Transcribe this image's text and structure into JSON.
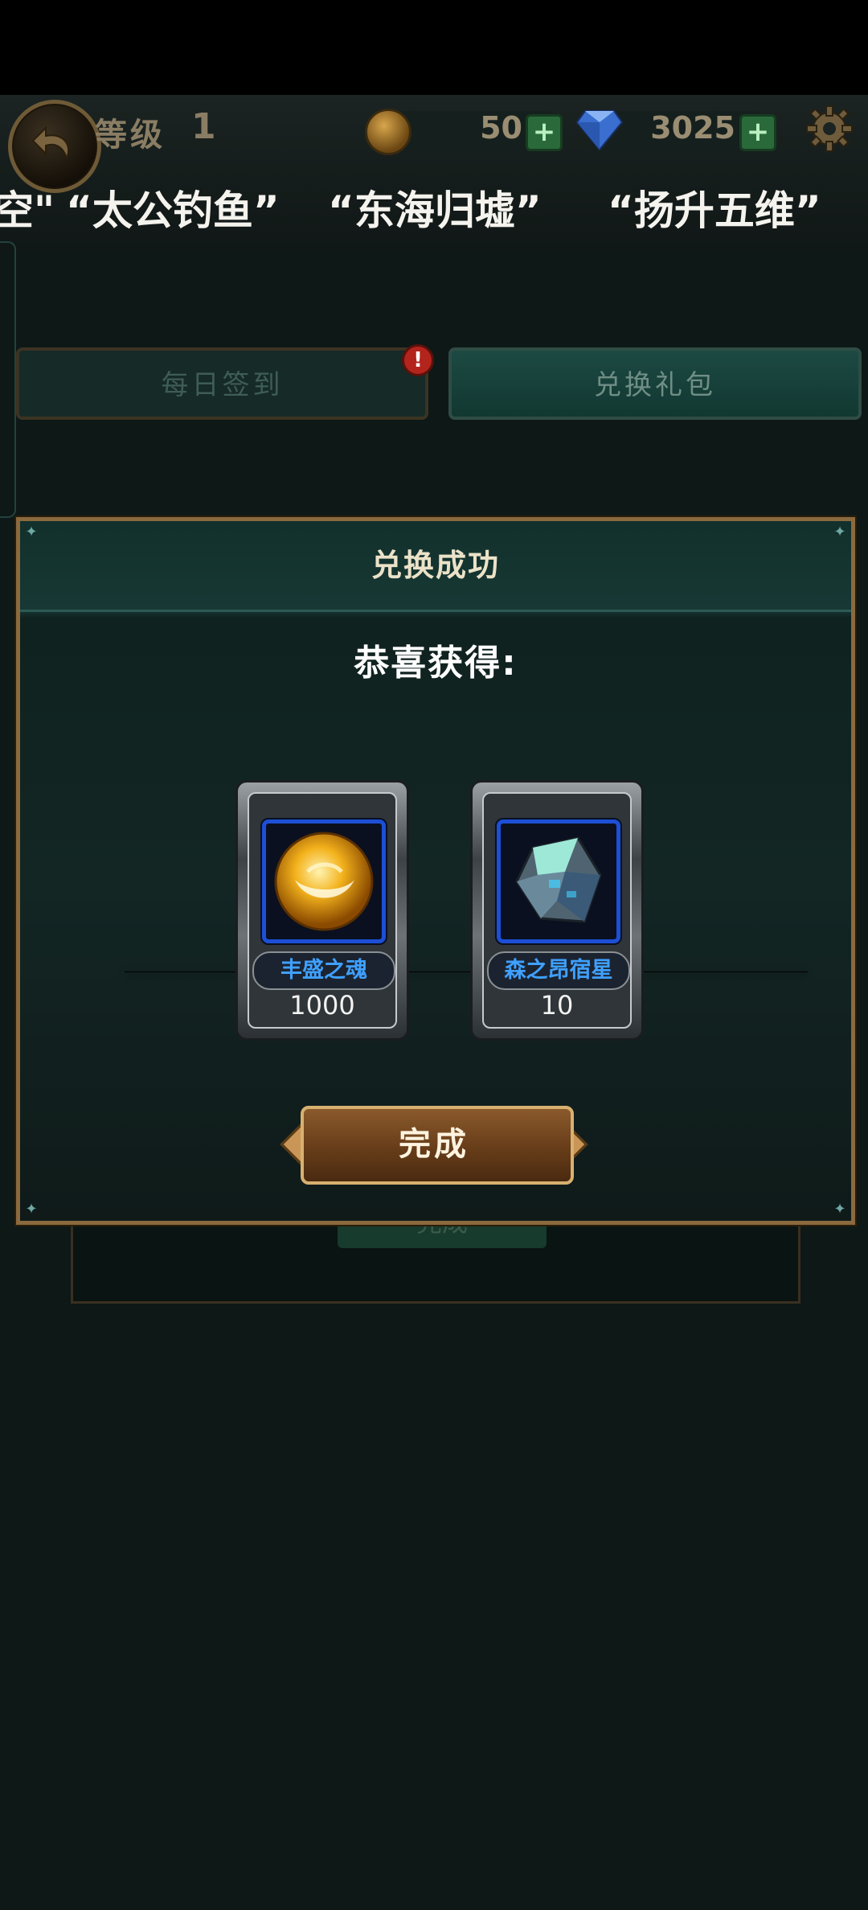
{
  "header": {
    "level_label": "等级",
    "level_value": "1",
    "coins": "50",
    "gems": "3025",
    "plus_label": "+"
  },
  "marquee": {
    "items": [
      "空\"",
      "“太公钓鱼”",
      "“东海归墟”",
      "“扬升五维”"
    ]
  },
  "tabs": {
    "daily": "每日签到",
    "gift": "兑换礼包",
    "alert": "!"
  },
  "background_panel": {
    "button_label": "完成"
  },
  "dialog": {
    "title": "兑换成功",
    "subtitle": "恭喜获得:",
    "rewards": [
      {
        "name": "丰盛之魂",
        "qty": "1000",
        "icon": "golden-orb-icon"
      },
      {
        "name": "森之昂宿星",
        "qty": "10",
        "icon": "crystal-shard-icon"
      }
    ],
    "confirm_label": "完成"
  },
  "colors": {
    "accent_gold": "#8a6a3e",
    "item_name_blue": "#3fa0ff",
    "icon_frame_blue": "#1d4fd6"
  }
}
